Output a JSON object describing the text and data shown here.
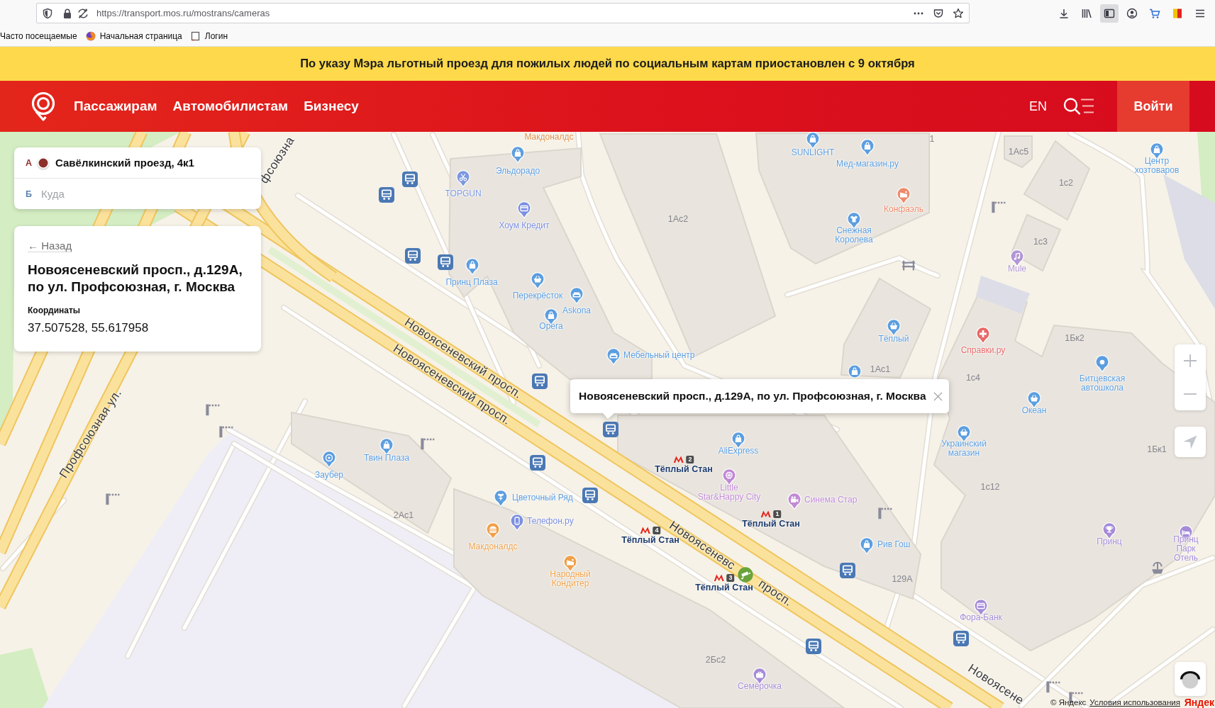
{
  "browser": {
    "url": "https://transport.mos.ru/mostrans/cameras",
    "bookmarks": [
      {
        "label": "Часто посещаемые"
      },
      {
        "label": "Начальная страница"
      },
      {
        "label": "Логин"
      }
    ]
  },
  "banner": {
    "text": "По указу Мэра льготный проезд для пожилых людей по социальным картам приостановлен с 9 октября"
  },
  "header": {
    "nav": [
      {
        "label": "Пассажирам"
      },
      {
        "label": "Автомобилистам"
      },
      {
        "label": "Бизнесу"
      }
    ],
    "language": "EN",
    "login": "Войти"
  },
  "route": {
    "from": {
      "letter": "А",
      "value": "Савёлкинский проезд, 4к1"
    },
    "to": {
      "letter": "Б",
      "placeholder": "Куда"
    }
  },
  "camera_card": {
    "back": "← Назад",
    "title": "Новоясеневский просп., д.129А, по ул. Профсоюзная, г. Москва",
    "coordinates_label": "Координаты",
    "coordinates": "37.507528, 55.617958"
  },
  "map": {
    "pois": [
      {
        "kind": "text",
        "name": "Макдоналдс",
        "color": "#e0904a"
      },
      {
        "kind": "pin",
        "name": "SUNLIGHT",
        "color": "#5c9ee0"
      },
      {
        "kind": "pin",
        "name": "Эльдорадо",
        "color": "#5c9ee0"
      },
      {
        "kind": "pin",
        "name": "Мед-магазин.ру",
        "color": "#5c9ee0"
      },
      {
        "kind": "pin",
        "name": "Центр\nхозтоваров",
        "color": "#5c9ee0"
      },
      {
        "kind": "pin",
        "name": "TOPGUN",
        "color": "#7c98e0"
      },
      {
        "kind": "pin",
        "name": "Конфаэль",
        "color": "#ef8a6a"
      },
      {
        "kind": "pin",
        "name": "Хоум Кредит",
        "color": "#7c8fe0"
      },
      {
        "kind": "pin",
        "name": "Снежная\nКоролева",
        "color": "#5c9ee0"
      },
      {
        "kind": "pin",
        "name": "Mule",
        "color": "#b196d4"
      },
      {
        "kind": "pin",
        "name": "Принц Плаза",
        "color": "#5c9ee0"
      },
      {
        "kind": "pin",
        "name": "Перекрёсток",
        "color": "#5c9ee0"
      },
      {
        "kind": "pin",
        "name": "Askona",
        "color": "#5c9ee0"
      },
      {
        "kind": "pin",
        "name": "Opera",
        "color": "#5c9ee0"
      },
      {
        "kind": "pin",
        "name": "Тёплый",
        "color": "#5c9ee0"
      },
      {
        "kind": "pin",
        "name": "Мебельный центр",
        "color": "#5c9ee0"
      },
      {
        "kind": "pin",
        "name": "Справки.ру",
        "color": "#e86868"
      },
      {
        "kind": "pin",
        "name": "Битцевская\nавтошкола",
        "color": "#5c9ee0"
      },
      {
        "kind": "pin",
        "name": "Океан",
        "color": "#5c9ee0"
      },
      {
        "kind": "pin",
        "name": "Твин Плаза",
        "color": "#5c9ee0"
      },
      {
        "kind": "pin",
        "name": "AliExpress",
        "color": "#5c9ee0"
      },
      {
        "kind": "pin",
        "name": "Украинский\nмагазин",
        "color": "#5c9ee0"
      },
      {
        "kind": "pin",
        "name": "Заубер",
        "color": "#5c9ee0"
      },
      {
        "kind": "pin",
        "name": "Цветочный Ряд",
        "color": "#5c9ee0"
      },
      {
        "kind": "pin",
        "name": "Little\nStar&Happy City",
        "color": "#c08ad4"
      },
      {
        "kind": "pin",
        "name": "Синема Стар",
        "color": "#c08ad4"
      },
      {
        "kind": "pin",
        "name": "Телефон.ру",
        "color": "#7c8fe0"
      },
      {
        "kind": "pin",
        "name": "Макдоналдс",
        "color": "#f0a048"
      },
      {
        "kind": "pin",
        "name": "Рив Гош",
        "color": "#5c9ee0"
      },
      {
        "kind": "pin",
        "name": "Принц",
        "color": "#a58bd8"
      },
      {
        "kind": "pin",
        "name": "Принц Парк\nОтель",
        "color": "#a58bd8"
      },
      {
        "kind": "pin",
        "name": "Народный\nКондитер",
        "color": "#f0a048"
      },
      {
        "kind": "pin",
        "name": "Фора-Банк",
        "color": "#a58bd8"
      },
      {
        "kind": "pin",
        "name": "Семёрочка",
        "color": "#a58bd8"
      }
    ],
    "buildings": [
      "1",
      "1Ас5",
      "1с2",
      "1Ас2",
      "1с3",
      "1Бк2",
      "1Ас1",
      "1с4",
      "1Бк1",
      "1с12",
      "2Ас1",
      "129А",
      "2Бс2"
    ],
    "streets": [
      "фсоюзна",
      "Новоясеневский просп.",
      "Новоясеневский просп.",
      "Профсоюзная ул.",
      "Новоясеневс",
      "просп.",
      "Новоясене"
    ],
    "metro": [
      {
        "name": "Тёплый Стан",
        "line": "2"
      },
      {
        "name": "Тёплый Стан",
        "line": "1"
      },
      {
        "name": "Тёплый Стан",
        "line": "4"
      },
      {
        "name": "Тёплый Стан",
        "line": "3"
      }
    ],
    "balloon": {
      "text": "Новоясеневский просп., д.129А, по ул. Профсоюзная, г. Москва"
    },
    "attribution": {
      "copyright": "© Яндекс",
      "terms": "Условия использования",
      "logo": "Яндек"
    }
  }
}
